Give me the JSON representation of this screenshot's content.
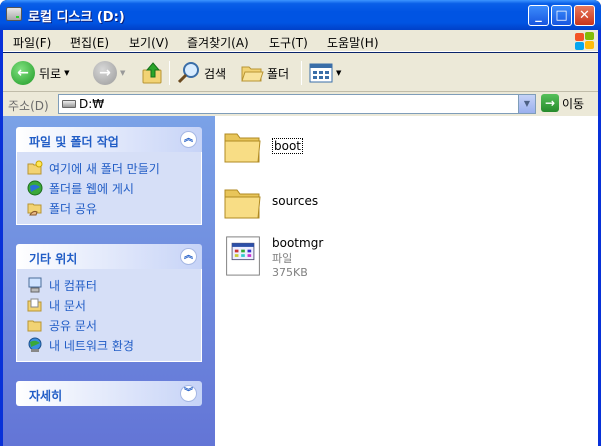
{
  "window": {
    "title": "로컬 디스크 (D:)"
  },
  "menu": [
    "파일(F)",
    "편집(E)",
    "보기(V)",
    "즐겨찾기(A)",
    "도구(T)",
    "도움말(H)"
  ],
  "toolbar": {
    "back_label": "뒤로",
    "search_label": "검색",
    "folders_label": "폴더"
  },
  "address": {
    "label": "주소(D)",
    "value": "D:₩",
    "go_label": "이동"
  },
  "panels": {
    "file_tasks": {
      "title": "파일 및 폴더 작업",
      "items": [
        "여기에 새 폴더 만들기",
        "폴더를 웹에 게시",
        "폴더 공유"
      ]
    },
    "other_places": {
      "title": "기타 위치",
      "items": [
        "내 컴퓨터",
        "내 문서",
        "공유 문서",
        "내 네트워크 환경"
      ]
    },
    "details": {
      "title": "자세히"
    }
  },
  "files": [
    {
      "name": "boot",
      "type": "folder"
    },
    {
      "name": "sources",
      "type": "folder"
    },
    {
      "name": "bootmgr",
      "type": "file",
      "kind": "파일",
      "size": "375KB"
    }
  ],
  "colors": {
    "titlebar": "#0054e3",
    "taskpane_top": "#7ba2e7",
    "link": "#215dc6"
  }
}
